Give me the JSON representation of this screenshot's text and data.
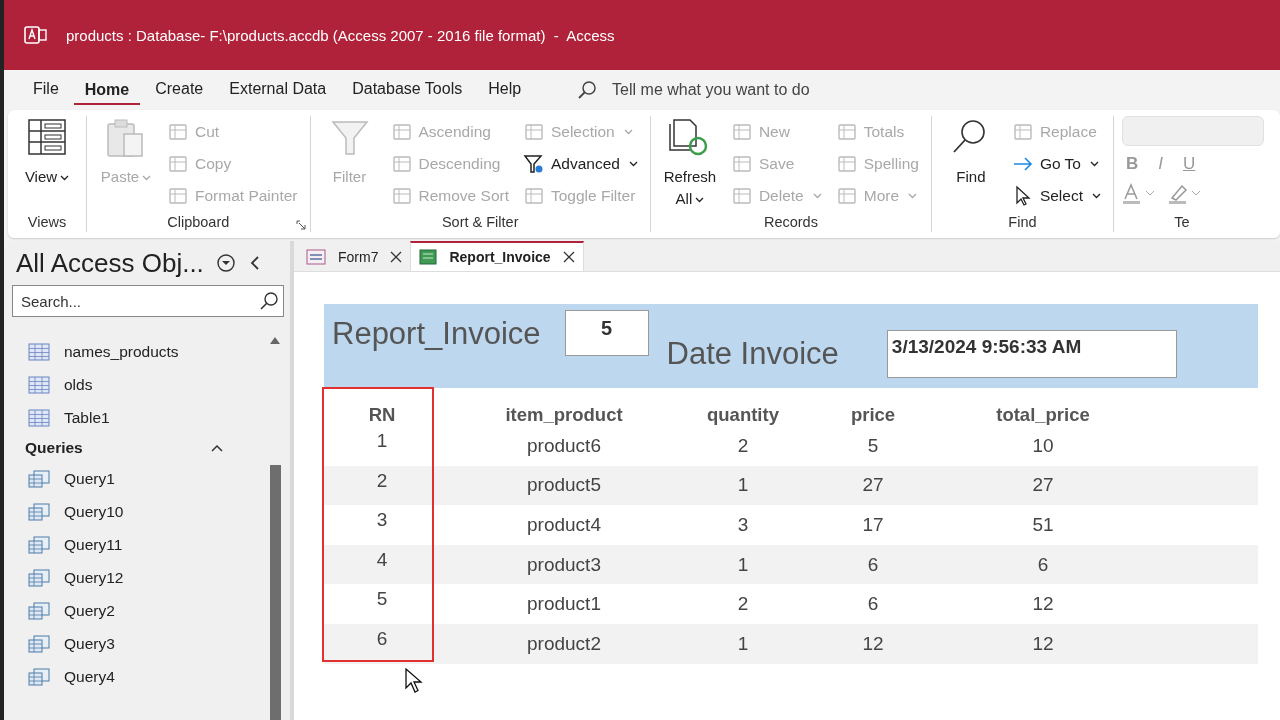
{
  "window": {
    "title": "products : Database- F:\\products.accdb (Access 2007 - 2016 file format)  -  Access"
  },
  "menu": [
    {
      "label": "File",
      "selected": false
    },
    {
      "label": "Home",
      "selected": true
    },
    {
      "label": "Create",
      "selected": false
    },
    {
      "label": "External Data",
      "selected": false
    },
    {
      "label": "Database Tools",
      "selected": false
    },
    {
      "label": "Help",
      "selected": false
    }
  ],
  "tell_me": {
    "placeholder": "Tell me what you want to do"
  },
  "ribbon": [
    {
      "label": "Views",
      "launcher": false,
      "columns": [
        [
          {
            "kind": "large",
            "label": "View",
            "disabled": false,
            "dropdown": true
          }
        ]
      ]
    },
    {
      "label": "Clipboard",
      "launcher": true,
      "columns": [
        [
          {
            "kind": "large",
            "label": "Paste",
            "disabled": true,
            "dropdown": true
          }
        ],
        [
          {
            "kind": "small",
            "label": "Cut",
            "disabled": true,
            "dropdown": false
          },
          {
            "kind": "small",
            "label": "Copy",
            "disabled": true,
            "dropdown": false
          },
          {
            "kind": "small",
            "label": "Format Painter",
            "disabled": true,
            "dropdown": false
          }
        ]
      ]
    },
    {
      "label": "Sort & Filter",
      "launcher": false,
      "columns": [
        [
          {
            "kind": "large",
            "label": "Filter",
            "disabled": true,
            "dropdown": false
          }
        ],
        [
          {
            "kind": "small",
            "label": "Ascending",
            "disabled": true,
            "dropdown": false
          },
          {
            "kind": "small",
            "label": "Descending",
            "disabled": true,
            "dropdown": false
          },
          {
            "kind": "small",
            "label": "Remove Sort",
            "disabled": true,
            "dropdown": false
          }
        ],
        [
          {
            "kind": "small",
            "label": "Selection",
            "disabled": true,
            "dropdown": true
          },
          {
            "kind": "small",
            "label": "Advanced",
            "disabled": false,
            "dropdown": true
          },
          {
            "kind": "small",
            "label": "Toggle Filter",
            "disabled": true,
            "dropdown": false
          }
        ]
      ]
    },
    {
      "label": "Records",
      "launcher": false,
      "columns": [
        [
          {
            "kind": "large",
            "label": "Refresh All",
            "disabled": false,
            "dropdown": true
          }
        ],
        [
          {
            "kind": "small",
            "label": "New",
            "disabled": true,
            "dropdown": false
          },
          {
            "kind": "small",
            "label": "Save",
            "disabled": true,
            "dropdown": false
          },
          {
            "kind": "small",
            "label": "Delete",
            "disabled": true,
            "dropdown": true
          }
        ],
        [
          {
            "kind": "small",
            "label": "Totals",
            "disabled": true,
            "dropdown": false
          },
          {
            "kind": "small",
            "label": "Spelling",
            "disabled": true,
            "dropdown": false
          },
          {
            "kind": "small",
            "label": "More",
            "disabled": true,
            "dropdown": true
          }
        ]
      ]
    },
    {
      "label": "Find",
      "launcher": false,
      "columns": [
        [
          {
            "kind": "large",
            "label": "Find",
            "disabled": false,
            "dropdown": false
          }
        ],
        [
          {
            "kind": "small",
            "label": "Replace",
            "disabled": true,
            "dropdown": false
          },
          {
            "kind": "small",
            "label": "Go To",
            "disabled": false,
            "dropdown": true
          },
          {
            "kind": "small",
            "label": "Select",
            "disabled": false,
            "dropdown": true
          }
        ]
      ]
    },
    {
      "label": "Te",
      "launcher": false,
      "columns": [
        [
          {
            "kind": "field",
            "disabled": true
          },
          {
            "kind": "format",
            "label": "B",
            "disabled": true
          },
          {
            "kind": "format",
            "label": "I",
            "disabled": true
          },
          {
            "kind": "format",
            "label": "U",
            "disabled": true
          }
        ]
      ]
    }
  ],
  "navigation": {
    "title": "All Access Obj...",
    "search": {
      "placeholder": "Search..."
    },
    "sections": [
      {
        "items": [
          {
            "kind": "table",
            "label": "names_products"
          },
          {
            "kind": "table",
            "label": "olds"
          },
          {
            "kind": "table",
            "label": "Table1"
          }
        ]
      },
      {
        "label": "Queries",
        "expanded": true,
        "items": [
          {
            "kind": "query",
            "label": "Query1"
          },
          {
            "kind": "query",
            "label": "Query10"
          },
          {
            "kind": "query",
            "label": "Query11"
          },
          {
            "kind": "query",
            "label": "Query12"
          },
          {
            "kind": "query",
            "label": "Query2"
          },
          {
            "kind": "query",
            "label": "Query3"
          },
          {
            "kind": "query",
            "label": "Query4"
          }
        ]
      }
    ]
  },
  "tabs": [
    {
      "kind": "form",
      "label": "Form7",
      "selected": false
    },
    {
      "kind": "report",
      "label": "Report_Invoice",
      "selected": true
    }
  ],
  "report": {
    "title": "Report_Invoice",
    "invoice_number": "5",
    "date_label": "Date Invoice",
    "date_value": "3/13/2024 9:56:33 AM",
    "columns": [
      "RN",
      "item_product",
      "quantity",
      "price",
      "total_price"
    ],
    "rows": [
      [
        "1",
        "product6",
        "2",
        "5",
        "10"
      ],
      [
        "2",
        "product5",
        "1",
        "27",
        "27"
      ],
      [
        "3",
        "product4",
        "3",
        "17",
        "51"
      ],
      [
        "4",
        "product3",
        "1",
        "6",
        "6"
      ],
      [
        "5",
        "product1",
        "2",
        "6",
        "12"
      ],
      [
        "6",
        "product2",
        "1",
        "12",
        "12"
      ]
    ],
    "highlight_first_column": true
  }
}
